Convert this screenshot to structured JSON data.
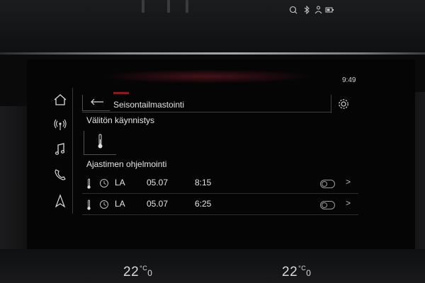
{
  "status_bar": {
    "time": "9:49",
    "icons": [
      "navigation-active-icon",
      "bluetooth-icon",
      "user-profile-icon",
      "phone-battery-icon"
    ]
  },
  "nav_rail": {
    "items": [
      {
        "name": "home-icon"
      },
      {
        "name": "radio-icon"
      },
      {
        "name": "music-icon"
      },
      {
        "name": "phone-icon"
      },
      {
        "name": "navigation-icon"
      }
    ]
  },
  "header": {
    "title": "Seisontailmastointi",
    "back_icon": "back-arrow-icon",
    "settings_icon": "gear-icon"
  },
  "immediate_start": {
    "heading": "Välitön käynnistys",
    "button_icon": "thermometer-icon"
  },
  "timers": {
    "heading": "Ajastimen ohjelmointi",
    "rows": [
      {
        "day": "LA",
        "date": "05.07",
        "time": "8:15",
        "enabled": false
      },
      {
        "day": "LA",
        "date": "05.07",
        "time": "6:25",
        "enabled": false
      }
    ]
  },
  "climate": {
    "left_temp_int": "22",
    "left_temp_dec": "0",
    "right_temp_int": "22",
    "right_temp_dec": "0",
    "unit": "°C"
  }
}
